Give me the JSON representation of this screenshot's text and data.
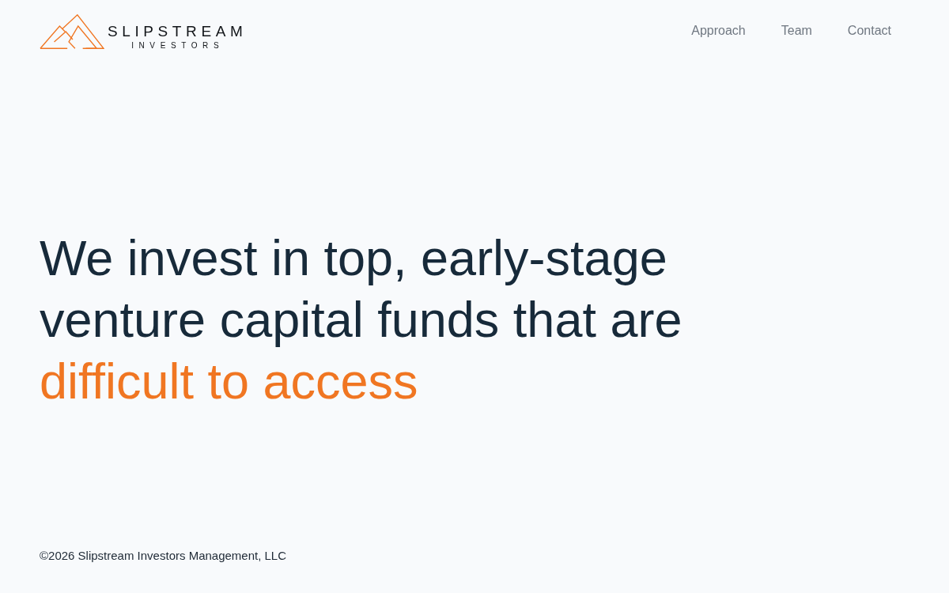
{
  "header": {
    "logo": {
      "name": "SLIPSTREAM",
      "tagline": "INVESTORS"
    },
    "nav": [
      {
        "label": "Approach"
      },
      {
        "label": "Team"
      },
      {
        "label": "Contact"
      }
    ]
  },
  "hero": {
    "headline": "We invest in top, early-stage venture capital funds that are",
    "highlight": "difficult to access"
  },
  "footer": {
    "copyright": "©2026 Slipstream Investors Management, LLC"
  }
}
